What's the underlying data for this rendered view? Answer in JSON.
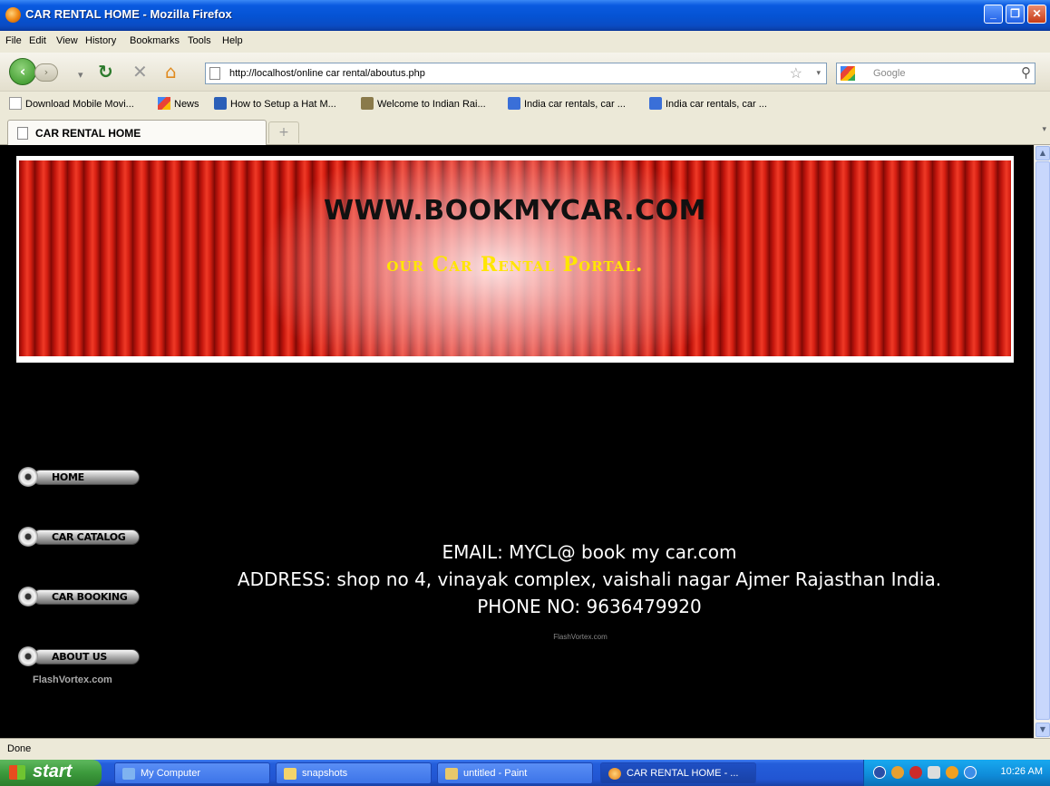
{
  "window": {
    "title": "CAR RENTAL HOME - Mozilla Firefox",
    "controls": [
      "minimize",
      "maximize",
      "close"
    ]
  },
  "menubar": [
    "File",
    "Edit",
    "View",
    "History",
    "Bookmarks",
    "Tools",
    "Help"
  ],
  "toolbar": {
    "url": "http://localhost/online car rental/aboutus.php",
    "search_placeholder": "Google"
  },
  "bookmarks": [
    "Download Mobile Movi...",
    "News",
    "How to Setup a Hat M...",
    "Welcome to Indian Rai...",
    "India car rentals, car ...",
    "India car rentals, car ..."
  ],
  "tabs": [
    {
      "label": "CAR RENTAL HOME"
    }
  ],
  "page": {
    "site_title": "WWW.BOOKMYCAR.COM",
    "site_subtitle": "our Car Rental Portal.",
    "nav": [
      "HOME",
      "CAR CATALOG",
      "CAR BOOKING",
      "ABOUT US"
    ],
    "nav_credit": "FlashVortex.com",
    "contact": {
      "email": "EMAIL: MYCL@ book my car.com",
      "address": "ADDRESS: shop no 4, vinayak complex, vaishali nagar Ajmer Rajasthan India.",
      "phone": "PHONE NO: 9636479920"
    },
    "content_credit": "FlashVortex.com"
  },
  "status": "Done",
  "taskbar": {
    "start": "start",
    "items": [
      "My Computer",
      "snapshots",
      "untitled - Paint",
      "CAR RENTAL HOME - ..."
    ],
    "clock": "10:26 AM"
  },
  "colors": {
    "titlebar": "#0553d3",
    "curtain_red": "#d41e12",
    "subtitle_yellow": "#ffe600",
    "content_bg": "#000000"
  }
}
